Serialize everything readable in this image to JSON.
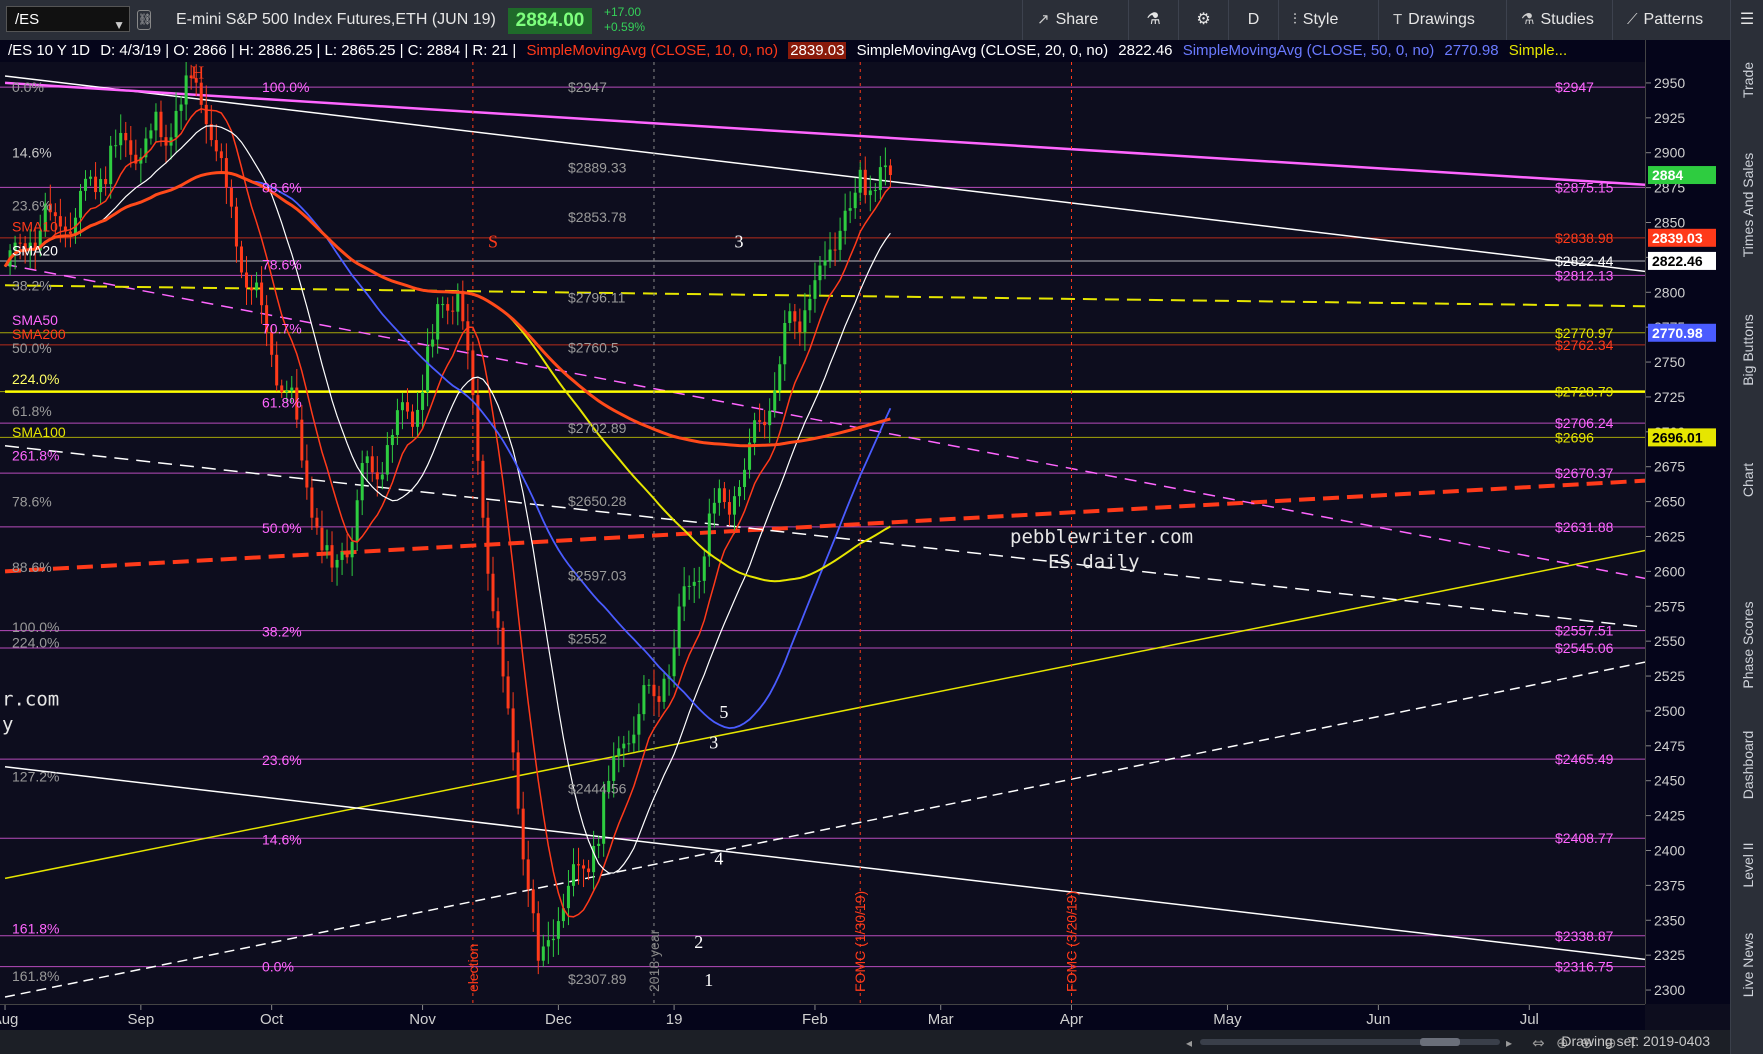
{
  "header": {
    "symbol": "/ES",
    "instrument_name": "E-mini S&P 500 Index Futures,ETH (JUN 19)",
    "last_price": "2884.00",
    "net_change": "+17.00",
    "pct_change": "+0.59%",
    "share_label": "Share",
    "period_label": "D",
    "style_label": "Style",
    "drawings_label": "Drawings",
    "studies_label": "Studies",
    "patterns_label": "Patterns"
  },
  "study_bar": {
    "symbol_period": "/ES 10 Y 1D",
    "ohlc": "D: 4/3/19 | O: 2866 | H: 2886.25 | L: 2865.25 | C: 2884 | R: 21 |",
    "sma10_label": "SimpleMovingAvg (CLOSE, 10, 0, no)",
    "sma10_value": "2839.03",
    "sma20_label": "SimpleMovingAvg (CLOSE, 20, 0, no)",
    "sma20_value": "2822.46",
    "sma50_label": "SimpleMovingAvg (CLOSE, 50, 0, no)",
    "sma50_value": "2770.98",
    "more": "Simple..."
  },
  "side_tabs": [
    "Trade",
    "Times And Sales",
    "Big Buttons",
    "Chart",
    "Phase Scores",
    "Dashboard",
    "Level II",
    "Live News"
  ],
  "bottom": {
    "drawing_set": "Drawing set: 2019-0403"
  },
  "watermark": {
    "line1": "pebblewriter.com",
    "line2": "ES daily",
    "left_fragment1": "r.com",
    "left_fragment2": "y"
  },
  "colors": {
    "background": "#0d0d1e",
    "candle_up": "#2ecc40",
    "candle_down": "#ff3a1a",
    "sma10": "#ff3a1a",
    "sma20": "#ffffff",
    "sma50": "#4a5cff",
    "sma200": "#ff4a1a",
    "sma100": "#e6e600",
    "fib": "#ff66ff",
    "level": "#c8c8c8"
  },
  "chart_data": {
    "type": "candlestick",
    "price_range": [
      2290,
      2965
    ],
    "price_ticks": [
      2300,
      2325,
      2350,
      2375,
      2400,
      2425,
      2450,
      2475,
      2500,
      2525,
      2550,
      2575,
      2600,
      2625,
      2650,
      2675,
      2700,
      2725,
      2750,
      2775,
      2800,
      2825,
      2850,
      2875,
      2900,
      2925,
      2950
    ],
    "x_labels": [
      "Aug",
      "Sep",
      "Oct",
      "Nov",
      "Dec",
      "19",
      "Feb",
      "Mar",
      "Apr",
      "May",
      "Jun",
      "Jul"
    ],
    "x_label_date_index": [
      0,
      27,
      53,
      83,
      110,
      133,
      161,
      186,
      212,
      243,
      273,
      303
    ],
    "x_range": [
      -1,
      326
    ],
    "last_candle": {
      "date": "4/3/19",
      "open": 2866,
      "high": 2886.25,
      "low": 2865.25,
      "close": 2884
    },
    "axis_markers": [
      {
        "value": 2884,
        "label": "2884",
        "color": "#2ecc40"
      },
      {
        "value": 2839.03,
        "label": "2839.03",
        "color": "#ff3a1a"
      },
      {
        "value": 2822.46,
        "label": "2822.46",
        "color": "#ffffff"
      },
      {
        "value": 2770.98,
        "label": "2770.98",
        "color": "#4a5cff"
      },
      {
        "value": 2696.01,
        "label": "2696.01",
        "color": "#e6e600"
      }
    ],
    "level_labels": [
      {
        "value": 2947,
        "label": "$2947",
        "color": "#ff66ff",
        "side": "right"
      },
      {
        "value": 2875.15,
        "label": "$2875.15",
        "color": "#ff66ff",
        "side": "right"
      },
      {
        "value": 2838.98,
        "label": "$2838.98",
        "color": "#ff3a1a",
        "side": "right"
      },
      {
        "value": 2822.44,
        "label": "$2822.44",
        "color": "#ffffff",
        "side": "right"
      },
      {
        "value": 2812.13,
        "label": "$2812.13",
        "color": "#ff66ff",
        "side": "right"
      },
      {
        "value": 2770.97,
        "label": "$2770.97",
        "color": "#e6e600",
        "side": "right"
      },
      {
        "value": 2762.34,
        "label": "$2762.34",
        "color": "#ff3a1a",
        "side": "right"
      },
      {
        "value": 2728.79,
        "label": "$2728.79",
        "color": "#e6e600",
        "side": "right"
      },
      {
        "value": 2706.24,
        "label": "$2706.24",
        "color": "#ff66ff",
        "side": "right"
      },
      {
        "value": 2696,
        "label": "$2696",
        "color": "#e6e600",
        "side": "right"
      },
      {
        "value": 2670.37,
        "label": "$2670.37",
        "color": "#ff66ff",
        "side": "right"
      },
      {
        "value": 2631.88,
        "label": "$2631.88",
        "color": "#ff66ff",
        "side": "right"
      },
      {
        "value": 2557.51,
        "label": "$2557.51",
        "color": "#ff66ff",
        "side": "right"
      },
      {
        "value": 2545.06,
        "label": "$2545.06",
        "color": "#ff66ff",
        "side": "right"
      },
      {
        "value": 2465.49,
        "label": "$2465.49",
        "color": "#ff66ff",
        "side": "right"
      },
      {
        "value": 2408.77,
        "label": "$2408.77",
        "color": "#ff66ff",
        "side": "right"
      },
      {
        "value": 2338.87,
        "label": "$2338.87",
        "color": "#ff66ff",
        "side": "right"
      },
      {
        "value": 2316.75,
        "label": "$2316.75",
        "color": "#ff66ff",
        "side": "right"
      },
      {
        "value": 2947,
        "label": "$2947",
        "color": "#9a9a9a",
        "side": "mid"
      },
      {
        "value": 2889.33,
        "label": "$2889.33",
        "color": "#9a9a9a",
        "side": "mid"
      },
      {
        "value": 2853.78,
        "label": "$2853.78",
        "color": "#9a9a9a",
        "side": "mid"
      },
      {
        "value": 2796.11,
        "label": "$2796.11",
        "color": "#9a9a9a",
        "side": "mid"
      },
      {
        "value": 2760.5,
        "label": "$2760.5",
        "color": "#9a9a9a",
        "side": "mid"
      },
      {
        "value": 2702.89,
        "label": "$2702.89",
        "color": "#9a9a9a",
        "side": "mid"
      },
      {
        "value": 2650.28,
        "label": "$2650.28",
        "color": "#9a9a9a",
        "side": "mid"
      },
      {
        "value": 2597.03,
        "label": "$2597.03",
        "color": "#9a9a9a",
        "side": "mid"
      },
      {
        "value": 2552,
        "label": "$2552",
        "color": "#9a9a9a",
        "side": "mid"
      },
      {
        "value": 2444.56,
        "label": "$2444.56",
        "color": "#9a9a9a",
        "side": "mid"
      },
      {
        "value": 2307.89,
        "label": "$2307.89",
        "color": "#9a9a9a",
        "side": "mid"
      }
    ],
    "fib_left": [
      {
        "value": 2947,
        "label": "100.0%",
        "color": "#ff66ff"
      },
      {
        "value": 2875,
        "label": "88.6%",
        "color": "#ff66ff"
      },
      {
        "value": 2820,
        "label": "78.6%",
        "color": "#ff66ff"
      },
      {
        "value": 2774,
        "label": "70.7%",
        "color": "#ff66ff"
      },
      {
        "value": 2721,
        "label": "61.8%",
        "color": "#ff66ff"
      },
      {
        "value": 2631,
        "label": "50.0%",
        "color": "#ff66ff"
      },
      {
        "value": 2557,
        "label": "38.2%",
        "color": "#ff66ff"
      },
      {
        "value": 2465,
        "label": "23.6%",
        "color": "#ff66ff"
      },
      {
        "value": 2408,
        "label": "14.6%",
        "color": "#ff66ff"
      },
      {
        "value": 2317,
        "label": "0.0%",
        "color": "#ff66ff"
      }
    ],
    "fib_far_left": [
      {
        "value": 2947,
        "label": "0.0%",
        "color": "#9a9a9a"
      },
      {
        "value": 2900,
        "label": "14.6%",
        "color": "#c8c8c8"
      },
      {
        "value": 2862,
        "label": "23.6%",
        "color": "#9a9a9a"
      },
      {
        "value": 2805,
        "label": "38.2%",
        "color": "#9a9a9a"
      },
      {
        "value": 2760,
        "label": "50.0%",
        "color": "#9a9a9a"
      },
      {
        "value": 2738,
        "label": "224.0%",
        "color": "#ffff66"
      },
      {
        "value": 2715,
        "label": "61.8%",
        "color": "#9a9a9a"
      },
      {
        "value": 2683,
        "label": "261.8%",
        "color": "#ff66ff"
      },
      {
        "value": 2650,
        "label": "78.6%",
        "color": "#9a9a9a"
      },
      {
        "value": 2603,
        "label": "88.6%",
        "color": "#9a9a9a"
      },
      {
        "value": 2560,
        "label": "100.0%",
        "color": "#9a9a9a"
      },
      {
        "value": 2549,
        "label": "224.0%",
        "color": "#9a9a9a"
      },
      {
        "value": 2453,
        "label": "127.2%",
        "color": "#9a9a9a"
      },
      {
        "value": 2344,
        "label": "161.8%",
        "color": "#ff66ff"
      },
      {
        "value": 2310,
        "label": "161.8%",
        "color": "#9a9a9a"
      }
    ],
    "sma_labels": [
      {
        "value": 2847,
        "label": "SMA10",
        "color": "#ff3a1a"
      },
      {
        "value": 2830,
        "label": "SMA20",
        "color": "#ffffff"
      },
      {
        "value": 2780,
        "label": "SMA50",
        "color": "#ff66ff"
      },
      {
        "value": 2770,
        "label": "SMA200",
        "color": "#ff3a1a"
      },
      {
        "value": 2700,
        "label": "SMA100",
        "color": "#e6e600"
      }
    ],
    "vertical_markers": [
      {
        "index": 93,
        "label": "election",
        "color": "#ff3a1a"
      },
      {
        "index": 129,
        "label": "2018 year",
        "color": "#888888"
      },
      {
        "index": 170,
        "label": "FOMC (1/30/19)",
        "color": "#ff3a1a"
      },
      {
        "index": 212,
        "label": "FOMC (3/20/19)",
        "color": "#ff3a1a"
      }
    ],
    "wave_labels": [
      {
        "index": 37,
        "value": 2953,
        "label": "H",
        "color": "#ff3a1a"
      },
      {
        "index": 96,
        "value": 2832,
        "label": "S",
        "color": "#ff3a1a"
      },
      {
        "index": 145,
        "value": 2832,
        "label": "3",
        "color": "#ffffff"
      },
      {
        "index": 137,
        "value": 2330,
        "label": "2",
        "color": "#ffffff"
      },
      {
        "index": 142,
        "value": 2495,
        "label": "5",
        "color": "#ffffff"
      },
      {
        "index": 140,
        "value": 2473,
        "label": "3",
        "color": "#ffffff"
      },
      {
        "index": 141,
        "value": 2390,
        "label": "4",
        "color": "#ffffff"
      },
      {
        "index": 139,
        "value": 2303,
        "label": "1",
        "color": "#ffffff"
      }
    ],
    "key_points": [
      {
        "date": "2018-09-21",
        "value": 2947
      },
      {
        "date": "2018-10-29",
        "value": 2603
      },
      {
        "date": "2018-12-03",
        "value": 2800
      },
      {
        "date": "2018-12-26",
        "value": 2317
      },
      {
        "date": "2019-03-21",
        "value": 2860
      },
      {
        "date": "2019-04-03",
        "value": 2884
      }
    ]
  }
}
